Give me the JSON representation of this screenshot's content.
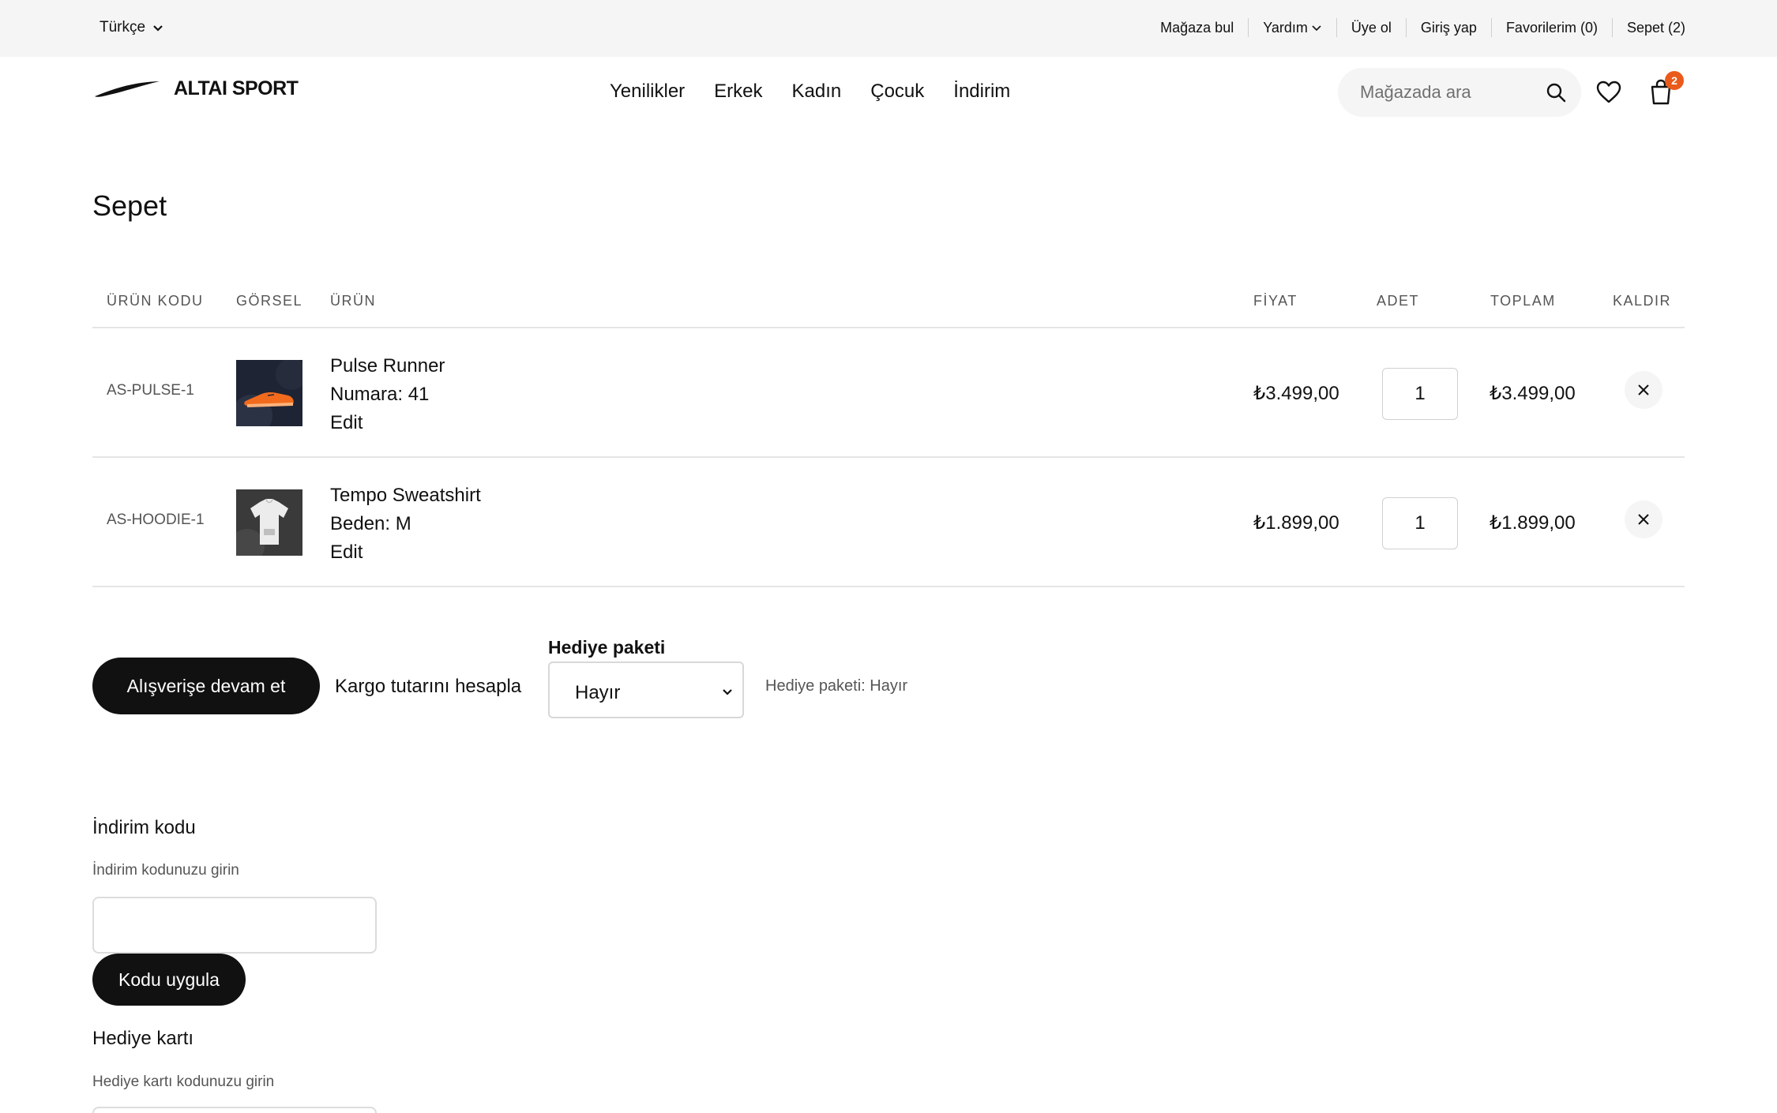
{
  "utility_bar": {
    "language": "Türkçe",
    "links": [
      "Mağaza bul",
      "Yardım",
      "Üye ol",
      "Giriş yap",
      "Favorilerim (0)",
      "Sepet (2)"
    ]
  },
  "header": {
    "brand": "ALTAI SPORT",
    "nav": [
      "Yenilikler",
      "Erkek",
      "Kadın",
      "Çocuk",
      "İndirim"
    ],
    "search_placeholder": "Mağazada ara",
    "cart_count": "2",
    "badge_color": "#ea5a1b"
  },
  "cart": {
    "title": "Sepet",
    "columns": {
      "sku": "ÜRÜN KODU",
      "image": "GÖRSEL",
      "product": "ÜRÜN",
      "price": "FİYAT",
      "qty": "ADET",
      "total": "TOPLAM",
      "remove": "KALDIR"
    },
    "items": [
      {
        "sku": "AS-PULSE-1",
        "name": "Pulse Runner",
        "variant": "Numara: 41",
        "edit": "Edit",
        "price": "₺3.499,00",
        "qty": "1",
        "total": "₺3.499,00",
        "image_icon": "orange-running-shoe"
      },
      {
        "sku": "AS-HOODIE-1",
        "name": "Tempo Sweatshirt",
        "variant": "Beden: M",
        "edit": "Edit",
        "price": "₺1.899,00",
        "qty": "1",
        "total": "₺1.899,00",
        "image_icon": "white-sweatshirt"
      }
    ]
  },
  "actions": {
    "continue_shopping": "Alışverişe devam et",
    "calculate_shipping": "Kargo tutarını hesapla",
    "gift_label": "Hediye paketi",
    "gift_value": "Hayır",
    "gift_status": "Hediye paketi: Hayır"
  },
  "discount": {
    "title": "İndirim kodu",
    "hint": "İndirim kodunuzu girin",
    "apply": "Kodu uygula"
  },
  "gift_card": {
    "title": "Hediye kartı",
    "hint": "Hediye kartı kodunuzu girin"
  }
}
